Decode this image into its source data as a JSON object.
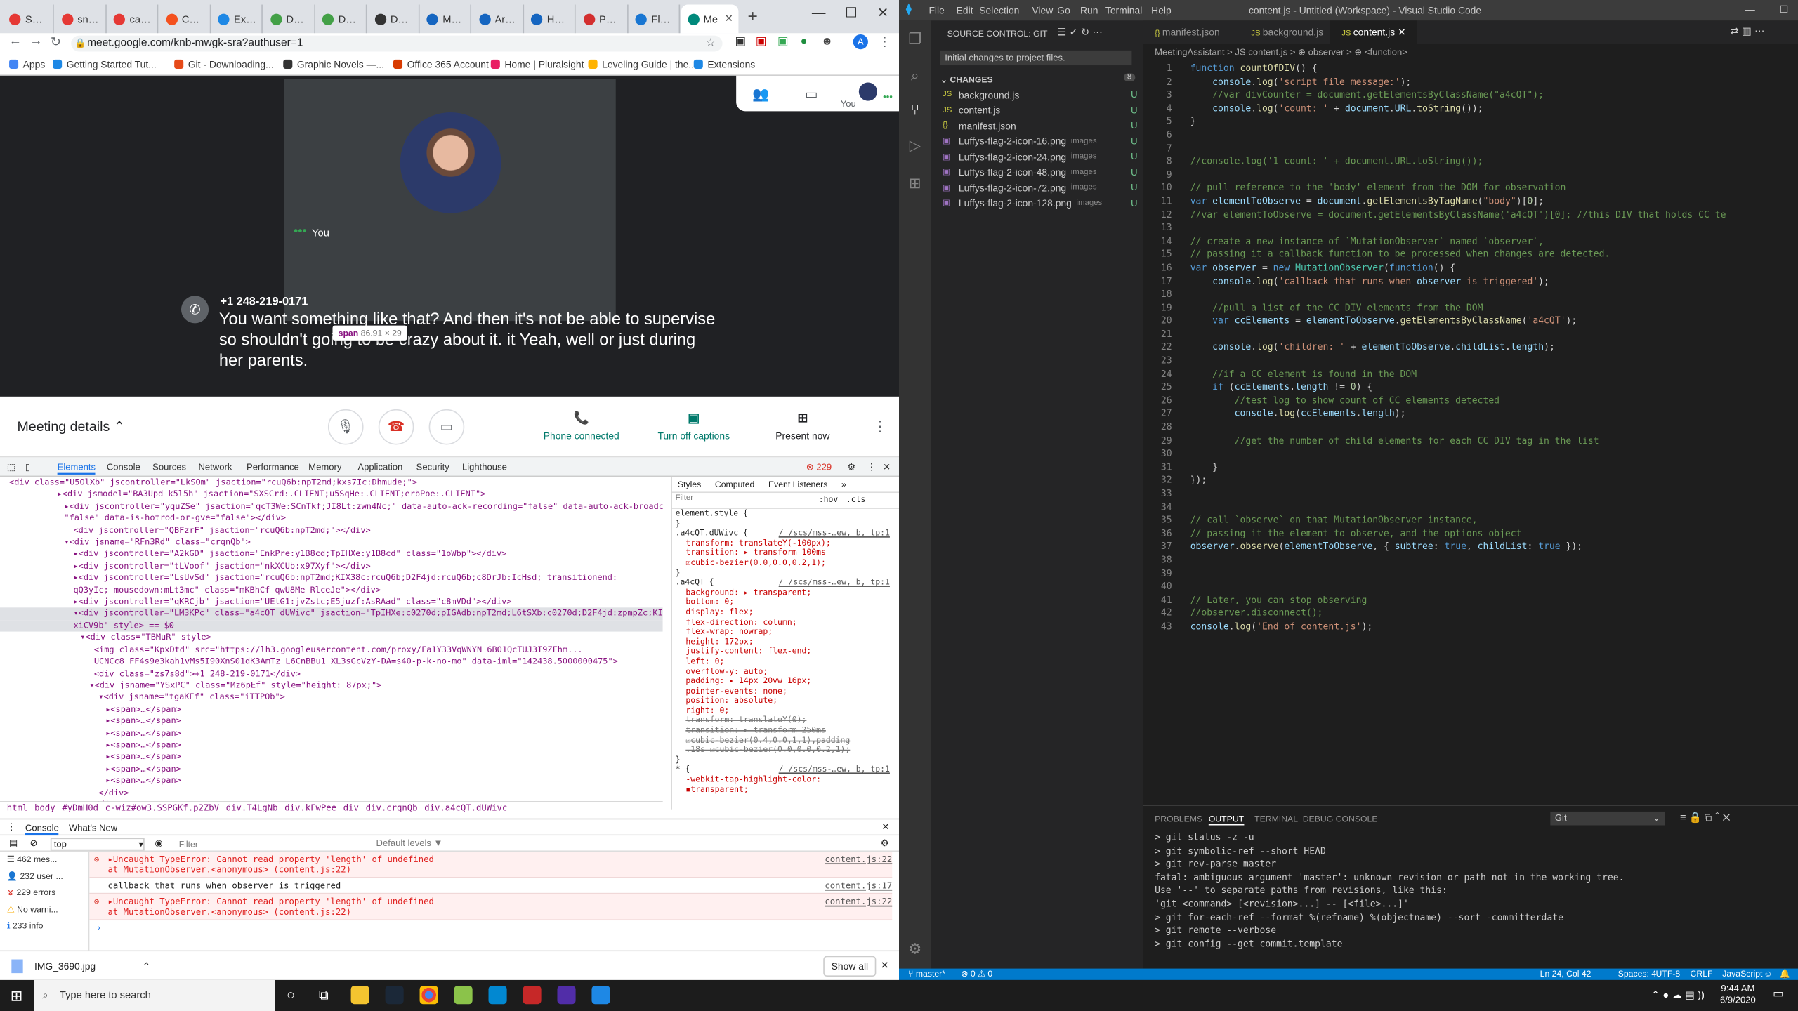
{
  "chrome": {
    "tabs": [
      {
        "label": "Snapp",
        "color": "#e53935"
      },
      {
        "label": "snapp",
        "color": "#e53935"
      },
      {
        "label": "catsn",
        "color": "#e53935"
      },
      {
        "label": "Conte",
        "color": "#f4511e"
      },
      {
        "label": "Exten",
        "color": "#1e88e5"
      },
      {
        "label": "DOM",
        "color": "#43a047"
      },
      {
        "label": "DOM",
        "color": "#43a047"
      },
      {
        "label": "Delay",
        "color": "#333333"
      },
      {
        "label": "Mutat",
        "color": "#1565c0"
      },
      {
        "label": "Array",
        "color": "#1565c0"
      },
      {
        "label": "HTML",
        "color": "#1565c0"
      },
      {
        "label": "Peter",
        "color": "#d32f2f"
      },
      {
        "label": "Flat C",
        "color": "#1976d2"
      },
      {
        "label": "Me",
        "color": "#00897b"
      }
    ],
    "url": "meet.google.com/knb-mwgk-sra?authuser=1",
    "bookmarks": [
      {
        "label": "Apps",
        "color": "#4285f4"
      },
      {
        "label": "Getting Started Tut...",
        "color": "#1e88e5"
      },
      {
        "label": "Git - Downloading...",
        "color": "#e64a19"
      },
      {
        "label": "Graphic Novels —...",
        "color": "#333333"
      },
      {
        "label": "Office 365 Account",
        "color": "#d83b01"
      },
      {
        "label": "Home | Pluralsight",
        "color": "#e91e63"
      },
      {
        "label": "Leveling Guide | the...",
        "color": "#ffb300"
      },
      {
        "label": "Extensions",
        "color": "#1e88e5"
      }
    ]
  },
  "meet": {
    "you_label": "You",
    "people_you": "You",
    "caller": "+1 248-219-0171",
    "caption": "You want something like that? And then it's not be able to supervise so shouldn't going to be crazy about it. it Yeah, well or just during her parents.",
    "tooltip_tag": "span",
    "tooltip_size": "86.91 × 29",
    "meeting_details": "Meeting details",
    "phone_connected": "Phone connected",
    "turn_off_captions": "Turn off captions",
    "present_now": "Present now"
  },
  "devtools": {
    "tabs": [
      "Elements",
      "Console",
      "Sources",
      "Network",
      "Performance",
      "Memory",
      "Application",
      "Security",
      "Lighthouse"
    ],
    "error_count": "229",
    "dom_lines": [
      "<div class=\"U5OlXb\" jscontroller=\"LkSOm\" jsaction=\"rcuQ6b:npT2md;kxs7Ic:Dhmude;\">",
      "▸<div jsmodel=\"BA3Upd k5l5h\" jsaction=\"SXSCrd:.CLIENT;u5SqHe:.CLIENT;erbPoe:.CLIENT\">",
      "▸<div jscontroller=\"yquZSe\" jsaction=\"qcT3We:SCnTkf;JI8Lt:zwn4Nc;\" data-auto-ack-recording=\"false\" data-auto-ack-broadcast=",
      "\"false\" data-is-hotrod-or-gve=\"false\"></div>",
      "<div jscontroller=\"QBFzrF\" jsaction=\"rcuQ6b:npT2md;\"></div>",
      "▾<div jsname=\"RFn3Rd\" class=\"crqnQb\">",
      "▸<div jscontroller=\"A2kGD\" jsaction=\"EnkPre:y1B8cd;TpIHXe:y1B8cd\" class=\"1oWbp\"></div>",
      "▸<div jscontroller=\"tLVoof\" jsaction=\"nkXCUb:x97Xyf\"></div>",
      "▸<div jscontroller=\"LsUvSd\" jsaction=\"rcuQ6b:npT2md;KIX38c:rcuQ6b;D2F4jd:rcuQ6b;c8DrJb:IcHsd; transitionend:",
      "qQ3yIc; mousedown:mLt3mc\" class=\"mKBhCf qwU8Me RlceJe\"></div>",
      "▸<div jscontroller=\"qKRCjb\" jsaction=\"UEtG1:jvZstc;E5juzf:AsRAad\" class=\"c8mVDd\"></div>",
      "▾<div jscontroller=\"LM3KPc\" class=\"a4cQT dUWivc\" jsaction=\"TpIHXe:c0270d;pIGAdb:npT2md;L6tSXb:c0270d;D2F4jd:zpmpZc;KIX38c:",
      "xiCV9b\" style> == $0",
      "▾<div class=\"TBMuR\" style>",
      "<img class=\"KpxDtd\" src=\"https://lh3.googleusercontent.com/proxy/Fa1Y33VqWNYN_6BO1QcTUJ3I9ZFhm...",
      "UCNCc8_FF4s9e3kah1vMs5I90XnS01dK3AmTz_L6CnBBu1_XL3sGcVzY-DA=s40-p-k-no-mo\" data-iml=\"142438.5000000475\">",
      "<div class=\"zs7s8d\">+1 248-219-0171</div>",
      "▾<div jsname=\"YSxPC\" class=\"Mz6pEf\" style=\"height: 87px;\">",
      "▾<div jsname=\"tgaKEf\" class=\"iTTPOb\">",
      "▸<span>…</span>",
      "▸<span>…</span>",
      "▸<span>…</span>",
      "▸<span>…</span>",
      "▸<span>…</span>",
      "▸<span>…</span>",
      "▸<span>…</span>",
      "</div>",
      "</div>"
    ],
    "breadcrumb": [
      "html",
      "body",
      "#yDmH0d",
      "c-wiz#ow3.SSPGKf.p2ZbV",
      "div.T4LgNb",
      "div.kFwPee",
      "div",
      "div.crqnQb",
      "div.a4cQT.dUWivc"
    ],
    "style_tabs": [
      "Styles",
      "Computed",
      "Event Listeners",
      "»"
    ],
    "filter_placeholder": "Filter",
    "hov": ":hov",
    "cls": ".cls",
    "style_lines": [
      {
        "t": "element.style {",
        "k": "sel"
      },
      {
        "t": "}",
        "k": "sel"
      },
      {
        "t": ".a4cQT.dUWivc {",
        "k": "sel",
        "src": "/_/scs/mss-…ew, b, tp:1"
      },
      {
        "t": "transform: translateY(-100px);",
        "k": "prop"
      },
      {
        "t": "transition: ▸ transform 100ms",
        "k": "prop"
      },
      {
        "t": "   ☑cubic-bezier(0.0,0.0,0.2,1);",
        "k": "prop"
      },
      {
        "t": "}",
        "k": "sel"
      },
      {
        "t": ".a4cQT {",
        "k": "sel",
        "src": "/_/scs/mss-…ew, b, tp:1"
      },
      {
        "t": "background: ▸ transparent;",
        "k": "prop"
      },
      {
        "t": "bottom: 0;",
        "k": "prop"
      },
      {
        "t": "display: flex;",
        "k": "prop"
      },
      {
        "t": "flex-direction: column;",
        "k": "prop"
      },
      {
        "t": "flex-wrap: nowrap;",
        "k": "prop"
      },
      {
        "t": "height: 172px;",
        "k": "prop"
      },
      {
        "t": "justify-content: flex-end;",
        "k": "prop"
      },
      {
        "t": "left: 0;",
        "k": "prop"
      },
      {
        "t": "overflow-y: auto;",
        "k": "prop"
      },
      {
        "t": "padding: ▸ 14px 20vw 16px;",
        "k": "prop"
      },
      {
        "t": "pointer-events: none;",
        "k": "prop"
      },
      {
        "t": "position: absolute;",
        "k": "prop"
      },
      {
        "t": "right: 0;",
        "k": "prop"
      },
      {
        "t": "transform: translateY(0);",
        "k": "strike"
      },
      {
        "t": "transition: ▸ transform 250ms",
        "k": "strike"
      },
      {
        "t": "   ☑cubic-bezier(0.4,0.0,1,1),padding",
        "k": "strike"
      },
      {
        "t": "   .18s ☑cubic-bezier(0.0,0.0,0.2,1);",
        "k": "strike"
      },
      {
        "t": "}",
        "k": "sel"
      },
      {
        "t": "* {",
        "k": "sel",
        "src": "/_/scs/mss-…ew, b, tp:1"
      },
      {
        "t": "-webkit-tap-highlight-color:",
        "k": "prop"
      },
      {
        "t": "   ▪transparent;",
        "k": "prop"
      }
    ],
    "drawer_tabs": [
      "Console",
      "What's New"
    ],
    "context": "top",
    "console_filter": "Filter",
    "levels": "Default levels ▼",
    "sidebar": [
      "462 mes...",
      "232 user ...",
      "229 errors",
      "No warni...",
      "233 info"
    ],
    "messages": [
      {
        "type": "err",
        "text": "▸Uncaught TypeError: Cannot read property 'length' of undefined",
        "text2": "    at MutationObserver.<anonymous> (content.js:22)",
        "link": "content.js:22"
      },
      {
        "type": "log",
        "text": "callback that runs when observer is triggered",
        "text2": "",
        "link": "content.js:17"
      },
      {
        "type": "err",
        "text": "▸Uncaught TypeError: Cannot read property 'length' of undefined",
        "text2": "    at MutationObserver.<anonymous> (content.js:22)",
        "link": "content.js:22"
      }
    ]
  },
  "downloads": {
    "file": "IMG_3690.jpg",
    "show_all": "Show all"
  },
  "vscode": {
    "title": "content.js - Untitled (Workspace) - Visual Studio Code",
    "menu": [
      "File",
      "Edit",
      "Selection",
      "View",
      "Go",
      "Run",
      "Terminal",
      "Help"
    ],
    "sc_title": "SOURCE CONTROL: GIT",
    "commit_msg": "Initial changes to project files.",
    "changes_label": "CHANGES",
    "changes_count": "8",
    "files": [
      {
        "name": "background.js",
        "dir": "",
        "kind": "js"
      },
      {
        "name": "content.js",
        "dir": "",
        "kind": "js"
      },
      {
        "name": "manifest.json",
        "dir": "",
        "kind": "json"
      },
      {
        "name": "Luffys-flag-2-icon-16.png",
        "dir": "images",
        "kind": "img"
      },
      {
        "name": "Luffys-flag-2-icon-24.png",
        "dir": "images",
        "kind": "img"
      },
      {
        "name": "Luffys-flag-2-icon-48.png",
        "dir": "images",
        "kind": "img"
      },
      {
        "name": "Luffys-flag-2-icon-72.png",
        "dir": "images",
        "kind": "img"
      },
      {
        "name": "Luffys-flag-2-icon-128.png",
        "dir": "images",
        "kind": "img"
      }
    ],
    "u": "U",
    "editor_tabs": [
      "manifest.json",
      "background.js",
      "content.js"
    ],
    "breadcrumb": "MeetingAssistant  >  JS content.js  >  ⊕ observer  >  ⊕ <function>",
    "code": [
      "function countOfDIV() {",
      "    console.log('script file message:');",
      "    //var divCounter = document.getElementsByClassName(\"a4cQT\");",
      "    console.log('count: ' + document.URL.toString());",
      "}",
      "",
      "",
      "//console.log('1 count: ' + document.URL.toString());",
      "",
      "// pull reference to the 'body' element from the DOM for observation",
      "var elementToObserve = document.getElementsByTagName(\"body\")[0];",
      "//var elementToObserve = document.getElementsByClassName('a4cQT')[0]; //this DIV that holds CC te",
      "",
      "// create a new instance of `MutationObserver` named `observer`,",
      "// passing it a callback function to be processed when changes are detected.",
      "var observer = new MutationObserver(function() {",
      "    console.log('callback that runs when observer is triggered');",
      "",
      "    //pull a list of the CC DIV elements from the DOM",
      "    var ccElements = elementToObserve.getElementsByClassName('a4cQT');",
      "",
      "    console.log('children: ' + elementToObserve.childList.length);",
      "",
      "    //if a CC element is found in the DOM",
      "    if (ccElements.length != 0) {",
      "        //test log to show count of CC elements detected",
      "        console.log(ccElements.length);",
      "",
      "        //get the number of child elements for each CC DIV tag in the list",
      "",
      "    }",
      "});",
      "",
      "",
      "// call `observe` on that MutationObserver instance,",
      "// passing it the element to observe, and the options object",
      "observer.observe(elementToObserve, { subtree: true, childList: true });",
      "",
      "",
      "",
      "// Later, you can stop observing",
      "//observer.disconnect();",
      "console.log('End of content.js');"
    ],
    "panel_tabs": [
      "PROBLEMS",
      "OUTPUT",
      "TERMINAL",
      "DEBUG CONSOLE"
    ],
    "output_channel": "Git",
    "output": [
      "> git status -z -u",
      "> git symbolic-ref --short HEAD",
      "> git rev-parse master",
      "fatal: ambiguous argument 'master': unknown revision or path not in the working tree.",
      "Use '--' to separate paths from revisions, like this:",
      "'git <command> [<revision>...] -- [<file>...]'",
      "> git for-each-ref --format %(refname) %(objectname) --sort -committerdate",
      "> git remote --verbose",
      "> git config --get commit.template"
    ],
    "status_branch": "master*",
    "status_problems": "⊗ 0  ⚠ 0",
    "status_pos": "Ln 24, Col 42",
    "status_spaces": "Spaces: 4",
    "status_enc": "UTF-8",
    "status_eol": "CRLF",
    "status_lang": "JavaScript"
  },
  "taskbar": {
    "search": "Type here to search",
    "time": "9:44 AM",
    "date": "6/9/2020"
  }
}
